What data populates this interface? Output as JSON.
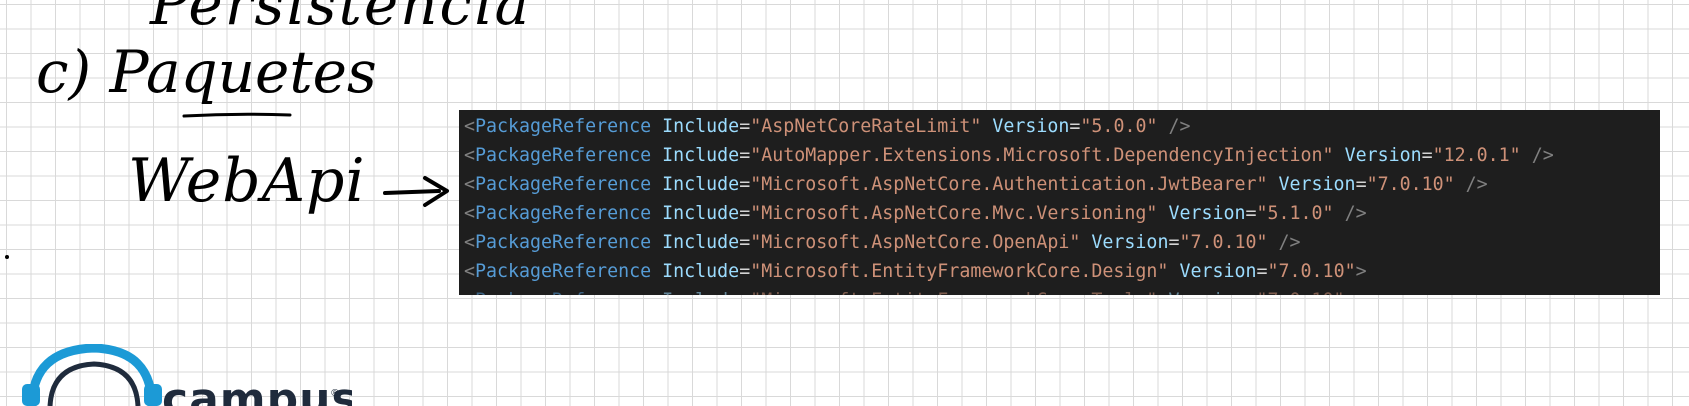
{
  "notes": {
    "top_word": "Persistencia",
    "section_label": "c) Paquetes",
    "webapi_label": "WebApi"
  },
  "code": {
    "lines": [
      {
        "tag_open": "<",
        "tag": "PackageReference",
        "attr1": "Include",
        "value1": "\"AspNetCoreRateLimit\"",
        "attr2": "Version",
        "value2": "\"5.0.0\"",
        "close": " />"
      },
      {
        "tag_open": "<",
        "tag": "PackageReference",
        "attr1": "Include",
        "value1": "\"AutoMapper.Extensions.Microsoft.DependencyInjection\"",
        "attr2": "Version",
        "value2": "\"12.0.1\"",
        "close": " />"
      },
      {
        "tag_open": "<",
        "tag": "PackageReference",
        "attr1": "Include",
        "value1": "\"Microsoft.AspNetCore.Authentication.JwtBearer\"",
        "attr2": "Version",
        "value2": "\"7.0.10\"",
        "close": " />"
      },
      {
        "tag_open": "<",
        "tag": "PackageReference",
        "attr1": "Include",
        "value1": "\"Microsoft.AspNetCore.Mvc.Versioning\"",
        "attr2": "Version",
        "value2": "\"5.1.0\"",
        "close": " />"
      },
      {
        "tag_open": "<",
        "tag": "PackageReference",
        "attr1": "Include",
        "value1": "\"Microsoft.AspNetCore.OpenApi\"",
        "attr2": "Version",
        "value2": "\"7.0.10\"",
        "close": " />"
      },
      {
        "tag_open": "<",
        "tag": "PackageReference",
        "attr1": "Include",
        "value1": "\"Microsoft.EntityFrameworkCore.Design\"",
        "attr2": "Version",
        "value2": "\"7.0.10\"",
        "close": ">"
      }
    ]
  },
  "logo": {
    "brand": "campus",
    "reg_mark": "®"
  },
  "colors": {
    "editor_bg": "#1e1e1e",
    "tag": "#569cd6",
    "attribute": "#9cdcfe",
    "string": "#ce9178",
    "punctuation": "#808080",
    "logo_blue": "#1c9ad6"
  }
}
